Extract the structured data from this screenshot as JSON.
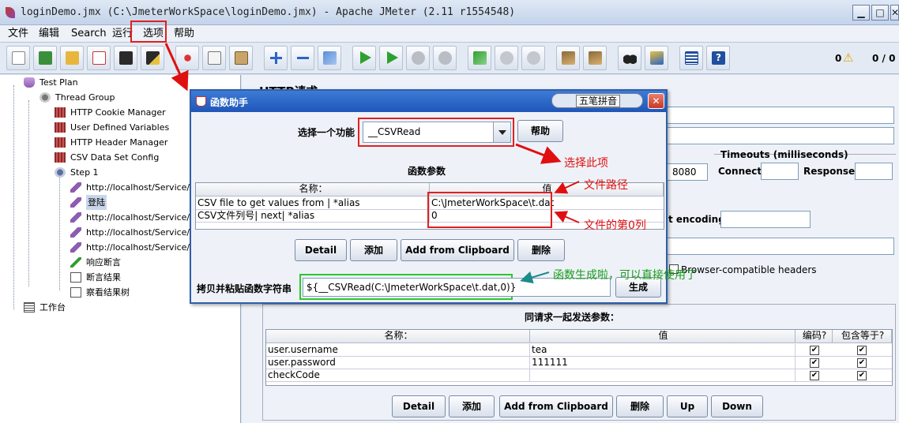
{
  "window": {
    "title": "loginDemo.jmx (C:\\JmeterWorkSpace\\loginDemo.jmx) - Apache JMeter (2.11 r1554548)",
    "min_glyph": "▁",
    "max_glyph": "□",
    "close_glyph": "✕"
  },
  "menu": [
    "文件",
    "编辑",
    "Search",
    "运行",
    "选项",
    "帮助"
  ],
  "toolbar": {
    "errors_count": "0",
    "warning_glyph": "⚠",
    "threads": "0 / 0"
  },
  "tree": {
    "nodes": [
      {
        "label": "Test Plan",
        "icon": "test-plan-icon"
      },
      {
        "label": "Thread Group",
        "icon": "thread-group-icon"
      },
      {
        "label": "HTTP Cookie Manager",
        "icon": "config-element-icon"
      },
      {
        "label": "User Defined Variables",
        "icon": "config-element-icon"
      },
      {
        "label": "HTTP Header Manager",
        "icon": "config-element-icon"
      },
      {
        "label": "CSV Data Set Config",
        "icon": "config-element-icon"
      },
      {
        "label": "Step 1",
        "icon": "controller-icon"
      },
      {
        "label": "http://localhost/Service/auth",
        "icon": "sampler-pen-icon"
      },
      {
        "label": "登陆",
        "icon": "sampler-pen-icon"
      },
      {
        "label": "http://localhost/Service/bas",
        "icon": "sampler-pen-icon"
      },
      {
        "label": "http://localhost/Service/we",
        "icon": "sampler-pen-icon"
      },
      {
        "label": "http://localhost/Service/res",
        "icon": "sampler-pen-icon"
      },
      {
        "label": "响应断言",
        "icon": "assertion-icon"
      },
      {
        "label": "断言结果",
        "icon": "listener-icon"
      },
      {
        "label": "察看结果树",
        "icon": "listener-icon"
      },
      {
        "label": "工作台",
        "icon": "workbench-icon"
      }
    ]
  },
  "http_panel": {
    "title": "HTTP请求",
    "port_value": "8080",
    "timeouts_label": "Timeouts (milliseconds)",
    "connect_label": "Connect:",
    "response_label": "Response:",
    "encoding_label": "t encoding:",
    "browser_headers_label": "Browser-compatible headers",
    "params_title": "同请求一起发送参数：",
    "params_headers": [
      "名称：",
      "值",
      "编码?",
      "包含等于?"
    ],
    "params": [
      {
        "name": "user.username",
        "value": "tea",
        "encode": true,
        "include_equals": true
      },
      {
        "name": "user.password",
        "value": "111111",
        "encode": true,
        "include_equals": true
      },
      {
        "name": "checkCode",
        "value": "",
        "encode": true,
        "include_equals": true
      }
    ],
    "buttons": [
      "Detail",
      "添加",
      "Add from Clipboard",
      "删除",
      "Up",
      "Down"
    ]
  },
  "dialog": {
    "title": "函数助手",
    "ime_label": "五笔拼音",
    "close_glyph": "✕",
    "select_label": "选择一个功能",
    "selected_function": "__CSVRead",
    "help_button": "帮助",
    "params_title": "函数参数",
    "headers": [
      "名称：",
      "值"
    ],
    "rows": [
      {
        "name": "CSV file to get values from | *alias",
        "value": "C:\\JmeterWorkSpace\\t.dat"
      },
      {
        "name": "CSV文件列号| next| *alias",
        "value": "0"
      }
    ],
    "buttons": [
      "Detail",
      "添加",
      "Add from Clipboard",
      "删除"
    ],
    "copy_label": "拷贝并粘贴函数字符串",
    "result_value": "${__CSVRead(C:\\JmeterWorkSpace\\t.dat,0)}",
    "generate_button": "生成"
  },
  "annotations": {
    "select_this": "选择此项",
    "file_path": "文件路径",
    "column_zero": "文件的第0列",
    "generated": "函数生成啦，可以直接使用了"
  },
  "colors": {
    "annotation_red": "#e01010",
    "annotation_green": "#1a9c1a",
    "dialog_title": "#1f56b8",
    "highlight_box_red": "#e02020",
    "highlight_box_green": "#2ec82e"
  }
}
